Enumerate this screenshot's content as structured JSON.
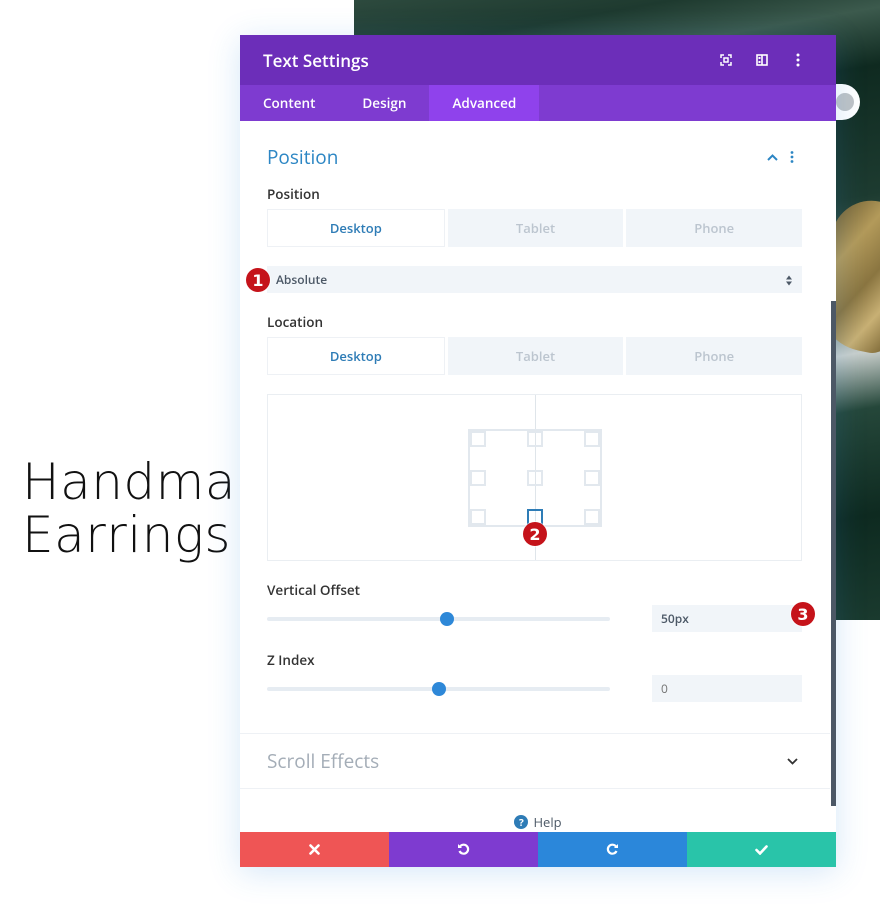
{
  "page": {
    "hero_title": "Handmade\nEarrings"
  },
  "modal": {
    "title": "Text Settings",
    "header_icons": [
      "expand-icon",
      "split-view-icon",
      "more-vertical-icon"
    ],
    "tabs": [
      {
        "label": "Content",
        "active": false
      },
      {
        "label": "Design",
        "active": false
      },
      {
        "label": "Advanced",
        "active": true
      }
    ],
    "sections": {
      "position": {
        "title": "Position",
        "expanded": true,
        "position_field": {
          "label": "Position",
          "device_tabs": [
            "Desktop",
            "Tablet",
            "Phone"
          ],
          "active_device": "Desktop",
          "value": "Absolute"
        },
        "location_field": {
          "label": "Location",
          "device_tabs": [
            "Desktop",
            "Tablet",
            "Phone"
          ],
          "active_device": "Desktop",
          "selected_location": "bottom-center"
        },
        "vertical_offset": {
          "label": "Vertical Offset",
          "value": "50px",
          "slider_fraction": 0.525
        },
        "z_index": {
          "label": "Z Index",
          "value": "",
          "placeholder": "0",
          "slider_fraction": 0.5
        }
      },
      "scroll_effects": {
        "title": "Scroll Effects",
        "expanded": false
      }
    },
    "help_label": "Help",
    "footer_buttons": [
      "cancel",
      "undo",
      "redo",
      "save"
    ]
  },
  "annotations": {
    "badge_1": "1",
    "badge_2": "2",
    "badge_3": "3"
  },
  "colors": {
    "header": "#6c2eb9",
    "tabs": "#7e3bd0",
    "tab_active": "#8f42ec",
    "accent_blue": "#2e7cb6",
    "cancel": "#ef5555",
    "undo": "#7e3bd0",
    "redo": "#2b87da",
    "save": "#29c4a9",
    "badge": "#c5131a"
  }
}
